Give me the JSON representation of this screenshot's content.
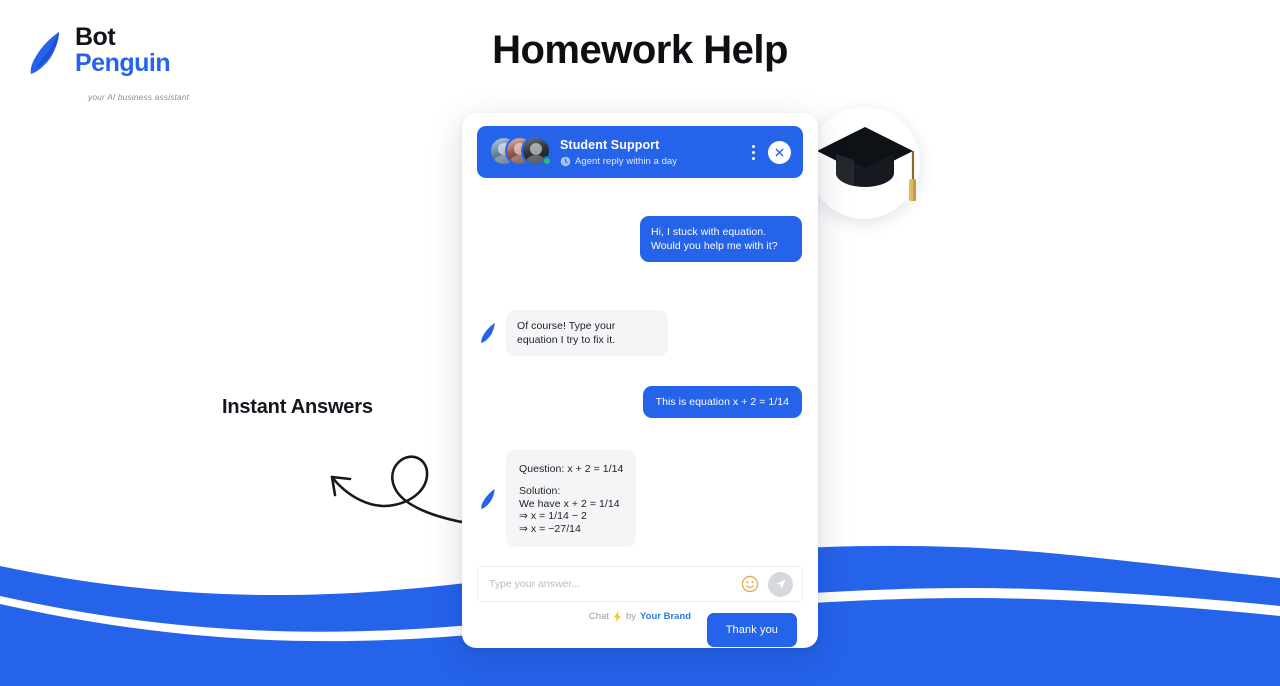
{
  "page": {
    "title": "Homework Help",
    "background_color": "#ffffff",
    "wave_color": "#2563eb"
  },
  "logo": {
    "name_line1": "Bot",
    "name_line2": "Penguin",
    "tagline": "your AI business assistant",
    "bird_icon": "penguin-icon",
    "brand_color": "#2563eb",
    "text_color": "#111418"
  },
  "annotation": {
    "label": "Instant Answers",
    "arrow_icon": "curly-arrow-icon"
  },
  "decoration": {
    "medallion_icon": "graduation-cap-icon"
  },
  "widget": {
    "header": {
      "title": "Student Support",
      "subtitle": "Agent reply within a day",
      "status_icon": "clock-icon",
      "menu_icon": "kebab-menu-icon",
      "close_icon": "close-icon",
      "online_status": "online",
      "avatar_count": 3,
      "accent_color": "#2563eb"
    },
    "messages": [
      {
        "sender": "user",
        "text": "Hi, I stuck with equation. Would you help me with it?"
      },
      {
        "sender": "bot",
        "avatar_icon": "penguin-icon",
        "text": "Of course! Type your equation I try to fix it."
      },
      {
        "sender": "user",
        "text": "This is equation x + 2 = 1/14"
      },
      {
        "sender": "bot",
        "avatar_icon": "penguin-icon",
        "question": "Question: x + 2 = 1/14",
        "solution_label": "Solution:",
        "solution_lines": [
          "We have x + 2 = 1/14",
          "⇒ x = 1/14 − 2",
          "⇒ x = −27/14"
        ]
      }
    ],
    "quick_reply": {
      "label": "Thank you"
    },
    "composer": {
      "placeholder": "Type your answer...",
      "value": "",
      "emoji_icon": "smiley-icon",
      "send_icon": "send-paper-plane-icon"
    },
    "footer": {
      "chat_label": "Chat",
      "bolt_icon": "lightning-bolt-icon",
      "by_label": "by",
      "brand_label": "Your Brand",
      "brand_color": "#2f7ae5"
    }
  }
}
